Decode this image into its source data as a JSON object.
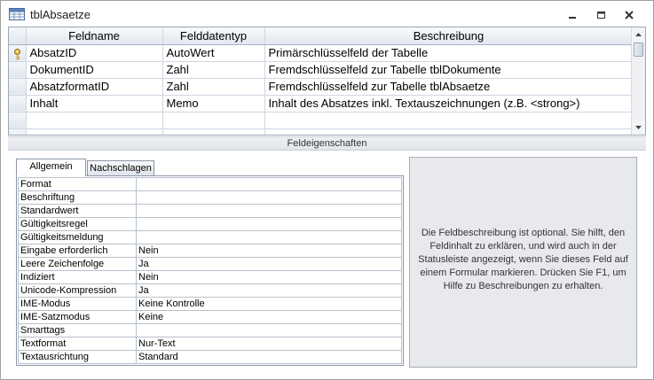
{
  "window": {
    "title": "tblAbsaetze",
    "icon": "table-icon",
    "buttons": [
      "minimize-icon",
      "maximize-icon",
      "close-icon"
    ]
  },
  "grid": {
    "columns": [
      "Feldname",
      "Felddatentyp",
      "Beschreibung"
    ],
    "rows": [
      {
        "name": "AbsatzID",
        "type": "AutoWert",
        "desc": "Primärschlüsselfeld der Tabelle",
        "key": true
      },
      {
        "name": "DokumentID",
        "type": "Zahl",
        "desc": "Fremdschlüsselfeld zur Tabelle tblDokumente",
        "key": false
      },
      {
        "name": "AbsatzformatID",
        "type": "Zahl",
        "desc": "Fremdschlüsselfeld zur Tabelle tblAbsaetze",
        "key": false
      },
      {
        "name": "Inhalt",
        "type": "Memo",
        "desc": "Inhalt des Absatzes inkl. Textauszeichnungen (z.B. <strong>)",
        "key": false
      }
    ]
  },
  "section_label": "Feldeigenschaften",
  "tabs": [
    "Allgemein",
    "Nachschlagen"
  ],
  "properties": [
    {
      "name": "Format",
      "value": ""
    },
    {
      "name": "Beschriftung",
      "value": ""
    },
    {
      "name": "Standardwert",
      "value": ""
    },
    {
      "name": "Gültigkeitsregel",
      "value": ""
    },
    {
      "name": "Gültigkeitsmeldung",
      "value": ""
    },
    {
      "name": "Eingabe erforderlich",
      "value": "Nein"
    },
    {
      "name": "Leere Zeichenfolge",
      "value": "Ja"
    },
    {
      "name": "Indiziert",
      "value": "Nein"
    },
    {
      "name": "Unicode-Kompression",
      "value": "Ja"
    },
    {
      "name": "IME-Modus",
      "value": "Keine Kontrolle"
    },
    {
      "name": "IME-Satzmodus",
      "value": "Keine"
    },
    {
      "name": "Smarttags",
      "value": ""
    },
    {
      "name": "Textformat",
      "value": "Nur-Text"
    },
    {
      "name": "Textausrichtung",
      "value": "Standard"
    }
  ],
  "help_text": "Die Feldbeschreibung ist optional. Sie hilft, den Feldinhalt zu erklären, und wird auch in der Statusleiste angezeigt, wenn Sie dieses Feld auf einem Formular markieren. Drücken Sie F1, um Hilfe zu Beschreibungen zu erhalten."
}
